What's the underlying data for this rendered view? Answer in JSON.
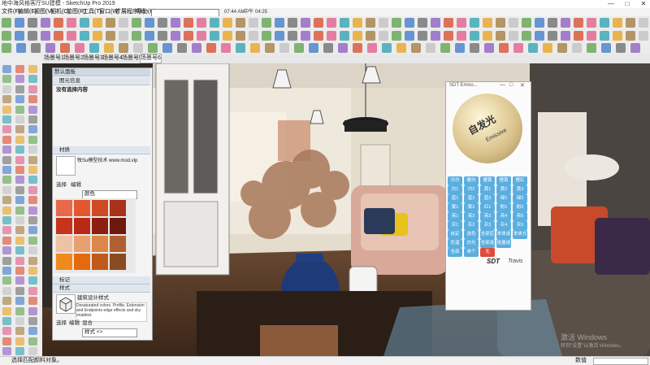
{
  "window": {
    "title": "地中海风格客厅SU建模 - SketchUp Pro 2019",
    "min": "—",
    "max": "□",
    "close": "✕"
  },
  "menu": [
    "文件(F)",
    "编辑(E)",
    "视图(V)",
    "相机(C)",
    "绘图(R)",
    "工具(T)",
    "窗口(W)",
    "扩展程序(x)",
    "帮助(H)"
  ],
  "readout": [
    "07:44 AM",
    "中午",
    "04:25 PM"
  ],
  "scene_tabs": [
    "场景号1",
    "场景号2",
    "场景号3",
    "场景号4",
    "场景号5",
    "场景号6"
  ],
  "tray": {
    "title": "默认面板",
    "entity_info": {
      "header": "图元信息",
      "text": "没有选择内容"
    },
    "materials": {
      "header": "材质",
      "name": "牧Su模型技术 www.mod.vip",
      "tabs": [
        "选择",
        "编辑"
      ],
      "dropdown": "颜色"
    },
    "styles": {
      "header": "样式",
      "sub": "标记",
      "name": "建筑设计样式",
      "desc": "Desaturated colors. Profile, Extension and Endpoints edge effects and sky enabled.",
      "tabs": [
        "选择",
        "编辑",
        "混合"
      ],
      "dropdown": "样式 <> "
    }
  },
  "swatch_colors": [
    "#e8684a",
    "#e25730",
    "#cf4a22",
    "#a8321c",
    "#c6341c",
    "#b82a16",
    "#8c1e12",
    "#6e180e",
    "#eec2a2",
    "#e8a070",
    "#dc8648",
    "#b06030",
    "#f08a1e",
    "#e46a10",
    "#c05a1a",
    "#8a4a22"
  ],
  "emissive": {
    "title": "SDT Emiss...",
    "ball_label": "自发光",
    "ball_sub": "Emissive",
    "buttons": [
      "冷白",
      "暖白",
      "暖黄",
      "橙黄",
      "橙红",
      "白1",
      "白2",
      "黄1",
      "黄2",
      "黄3",
      "蓝1",
      "蓝2",
      "蓝3",
      "绿1",
      "绿2",
      "紫1",
      "紫2",
      "红1",
      "粉1",
      "粉2",
      "亮1",
      "亮2",
      "亮3",
      "亮4",
      "亮5",
      "灰1",
      "灰2",
      "灰3",
      "灰4",
      "灰5",
      "自定",
      "选色",
      "全部应用",
      "本体选色",
      "本体光色",
      "色温",
      "白光",
      "全部选色",
      "批量选色",
      "",
      "全部",
      "单个",
      "无"
    ],
    "logo1": "SDT",
    "logo2": "Travis"
  },
  "watermark": {
    "line1": "激活 Windows",
    "line2": "转到\"设置\"以激活 Windows。"
  },
  "status": {
    "text": "选择匹配颜料对象。",
    "label": "数值"
  }
}
